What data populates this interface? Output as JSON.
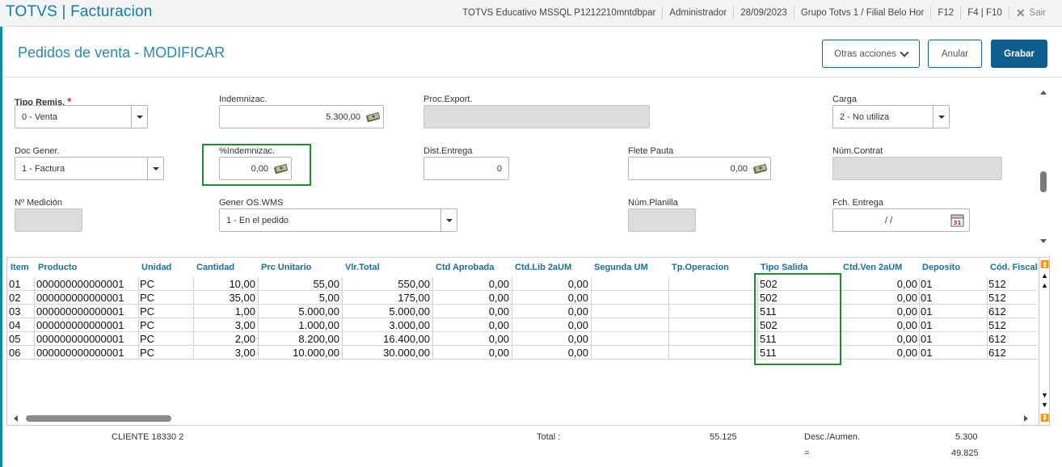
{
  "topbar": {
    "title": "TOTVS | Facturacion",
    "environment": "TOTVS Educativo MSSQL P1212210mntdbpar",
    "user": "Administrador",
    "date": "28/09/2023",
    "branch": "Grupo Totvs 1 / Filial Belo Hor",
    "shortcut1": "F12",
    "shortcut2": "F4 | F10",
    "logout": "Sair"
  },
  "header": {
    "title": "Pedidos de venta - MODIFICAR",
    "other_actions": "Otras acciones",
    "cancel": "Anular",
    "save": "Grabar"
  },
  "form": {
    "tipo_remis": {
      "label": "Tipo Remis.",
      "value": "0 - Venta"
    },
    "indemnizac": {
      "label": "Indemnizac.",
      "value": "5.300,00"
    },
    "proc_export": {
      "label": "Proc.Export.",
      "value": ""
    },
    "carga": {
      "label": "Carga",
      "value": "2 - No utiliza"
    },
    "doc_gener": {
      "label": "Doc Gener.",
      "value": "1 - Factura"
    },
    "pct_indemnizac": {
      "label": "%Indemnizac.",
      "value": "0,00"
    },
    "dist_entrega": {
      "label": "Dist.Entrega",
      "value": "0"
    },
    "flete_pauta": {
      "label": "Flete Pauta",
      "value": "0,00"
    },
    "num_contrat": {
      "label": "Núm.Contrat",
      "value": ""
    },
    "n_medicion": {
      "label": "Nº Medición",
      "value": ""
    },
    "gener_os_wms": {
      "label": "Gener OS.WMS",
      "value": "1 - En el pedido"
    },
    "num_planilla": {
      "label": "Núm.Planilla",
      "value": ""
    },
    "fch_entrega": {
      "label": "Fch. Entrega",
      "value": "/ /"
    }
  },
  "grid": {
    "columns": [
      "Item",
      "Producto",
      "Unidad",
      "Cantidad",
      "Prc Unitario",
      "Vlr.Total",
      "Ctd Aprobada",
      "Ctd.Lib 2aUM",
      "Segunda UM",
      "Tp.Operacion",
      "Tipo Salida",
      "Ctd.Ven 2aUM",
      "Deposito",
      "Cód. Fiscal"
    ],
    "rows": [
      {
        "item": "01",
        "producto": "000000000000001",
        "unidad": "PC",
        "cantidad": "10,00",
        "prc": "55,00",
        "total": "550,00",
        "aprob": "0,00",
        "lib2": "0,00",
        "segum": "",
        "tpop": "",
        "salida": "502",
        "ven2": "0,00",
        "deposito": "01",
        "cfiscal": "512"
      },
      {
        "item": "02",
        "producto": "000000000000001",
        "unidad": "PC",
        "cantidad": "35,00",
        "prc": "5,00",
        "total": "175,00",
        "aprob": "0,00",
        "lib2": "0,00",
        "segum": "",
        "tpop": "",
        "salida": "502",
        "ven2": "0,00",
        "deposito": "01",
        "cfiscal": "512"
      },
      {
        "item": "03",
        "producto": "000000000000001",
        "unidad": "PC",
        "cantidad": "1,00",
        "prc": "5.000,00",
        "total": "5.000,00",
        "aprob": "0,00",
        "lib2": "0,00",
        "segum": "",
        "tpop": "",
        "salida": "511",
        "ven2": "0,00",
        "deposito": "01",
        "cfiscal": "612"
      },
      {
        "item": "04",
        "producto": "000000000000001",
        "unidad": "PC",
        "cantidad": "3,00",
        "prc": "1.000,00",
        "total": "3.000,00",
        "aprob": "0,00",
        "lib2": "0,00",
        "segum": "",
        "tpop": "",
        "salida": "502",
        "ven2": "0,00",
        "deposito": "01",
        "cfiscal": "512"
      },
      {
        "item": "05",
        "producto": "000000000000001",
        "unidad": "PC",
        "cantidad": "2,00",
        "prc": "8.200,00",
        "total": "16.400,00",
        "aprob": "0,00",
        "lib2": "0,00",
        "segum": "",
        "tpop": "",
        "salida": "511",
        "ven2": "0,00",
        "deposito": "01",
        "cfiscal": "612"
      },
      {
        "item": "06",
        "producto": "000000000000001",
        "unidad": "PC",
        "cantidad": "3,00",
        "prc": "10.000,00",
        "total": "30.000,00",
        "aprob": "0,00",
        "lib2": "0,00",
        "segum": "",
        "tpop": "",
        "salida": "511",
        "ven2": "0,00",
        "deposito": "01",
        "cfiscal": "612"
      }
    ]
  },
  "footer": {
    "cliente": "CLIENTE 18330 2",
    "total_label": "Total :",
    "total_value": "55.125",
    "desc_label": "Desc./Aumen.",
    "desc_value": "5.300",
    "eq_label": "=",
    "net_value": "49.825"
  },
  "colors": {
    "accent": "#0b7fa5",
    "primary_button": "#0d5e8f",
    "highlight": "#238a2e",
    "required": "#d9232f"
  }
}
